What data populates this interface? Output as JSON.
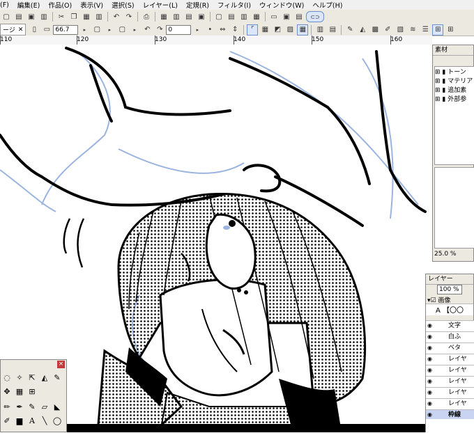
{
  "menu": {
    "items": [
      "(F)",
      "編集(E)",
      "作品(O)",
      "表示(V)",
      "選択(S)",
      "レイヤー(L)",
      "定規(R)",
      "フィルタ(I)",
      "ウィンドウ(W)",
      "ヘルプ(H)"
    ]
  },
  "toolbar2": {
    "tab_label": "ージ",
    "zoom_value": "66.7",
    "angle_value": "0"
  },
  "ruler": {
    "labels": [
      "110",
      "120",
      "130",
      "140",
      "150",
      "160"
    ]
  },
  "material_panel": {
    "title": "素材",
    "items": [
      "トーン",
      "マテリア",
      "追加素",
      "外部参"
    ],
    "zoom": "25.0 %"
  },
  "layer_panel": {
    "title": "レイヤー",
    "opacity": "100 %",
    "group_name": "画像",
    "text_header": "A 【〇〇",
    "layers": [
      "文字",
      "白ふ",
      "ベタ",
      "レイヤ",
      "レイヤ",
      "レイヤ",
      "レイヤ",
      "レイヤ"
    ],
    "selected_layer": "枠線"
  },
  "tool_palette": {
    "close_glyph": "×"
  }
}
